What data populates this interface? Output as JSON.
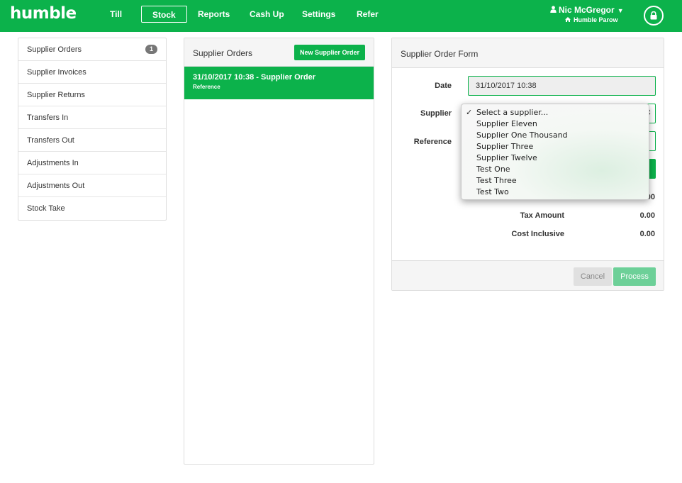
{
  "app": {
    "logo": "humble"
  },
  "nav": {
    "items": [
      {
        "label": "Till"
      },
      {
        "label": "Stock"
      },
      {
        "label": "Reports"
      },
      {
        "label": "Cash Up"
      },
      {
        "label": "Settings"
      },
      {
        "label": "Refer"
      }
    ],
    "active": "Stock"
  },
  "user": {
    "name": "Nic McGregor",
    "location": "Humble Parow"
  },
  "sidebar": {
    "items": [
      {
        "label": "Supplier Orders",
        "badge": "1"
      },
      {
        "label": "Supplier Invoices"
      },
      {
        "label": "Supplier Returns"
      },
      {
        "label": "Transfers In"
      },
      {
        "label": "Transfers Out"
      },
      {
        "label": "Adjustments In"
      },
      {
        "label": "Adjustments Out"
      },
      {
        "label": "Stock Take"
      }
    ]
  },
  "orders_panel": {
    "title": "Supplier Orders",
    "new_button": "New Supplier Order",
    "orders": [
      {
        "title": "31/10/2017 10:38 - Supplier Order",
        "subtitle": "Reference"
      }
    ]
  },
  "form": {
    "title": "Supplier Order Form",
    "date_label": "Date",
    "date_value": "31/10/2017 10:38",
    "supplier_label": "Supplier",
    "reference_label": "Reference",
    "partial_value": ".00",
    "tax_label": "Tax Amount",
    "tax_value": "0.00",
    "cost_label": "Cost Inclusive",
    "cost_value": "0.00",
    "cancel": "Cancel",
    "process": "Process"
  },
  "supplier_dropdown": {
    "selected": "Select a supplier...",
    "options": [
      "Select a supplier...",
      "Supplier Eleven",
      "Supplier One Thousand",
      "Supplier Three",
      "Supplier Twelve",
      "Test One",
      "Test Three",
      "Test Two"
    ]
  },
  "colors": {
    "brand": "#0cb24b",
    "process_disabled": "#6dd098"
  },
  "icons": [
    "user-icon",
    "caret-down-icon",
    "home-icon",
    "lock-icon",
    "checkmark-icon",
    "select-arrows-icon"
  ]
}
